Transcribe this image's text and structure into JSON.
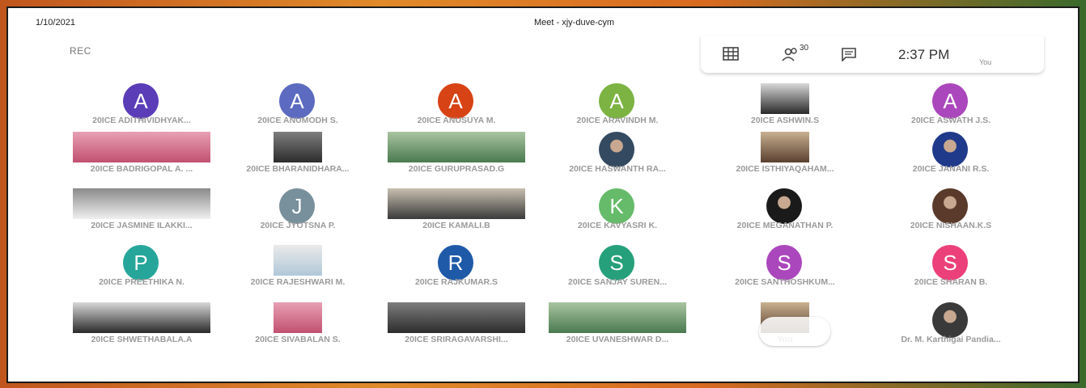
{
  "header": {
    "date": "1/10/2021",
    "meeting_title": "Meet - xjy-duve-cym",
    "rec_label": "REC"
  },
  "toolbar": {
    "grid_icon": "grid-layout-icon",
    "people_icon": "people-icon",
    "participant_count": "30",
    "chat_icon": "chat-icon",
    "time": "2:37  PM",
    "you_label": "You"
  },
  "colors": {
    "frame": "#b84a1c",
    "panel": "#ffffff",
    "name_text": "#9a9a9a"
  },
  "participants": [
    {
      "name": "20ICE ADITHIVIDHYAK...",
      "avatar": "A",
      "color": "#5b3db8",
      "kind": "avatar"
    },
    {
      "name": "20ICE ANUMODH S.",
      "avatar": "A",
      "color": "#5c6bc0",
      "kind": "avatar"
    },
    {
      "name": "20ICE ANUSUYA M.",
      "avatar": "A",
      "color": "#d84315",
      "kind": "avatar"
    },
    {
      "name": "20ICE ARAVINDH M.",
      "avatar": "A",
      "color": "#7cb342",
      "kind": "avatar"
    },
    {
      "name": "20ICE ASHWIN.S",
      "kind": "video"
    },
    {
      "name": "20ICE ASWATH J.S.",
      "avatar": "A",
      "color": "#ab47bc",
      "kind": "avatar"
    },
    {
      "name": "20ICE BADRIGOPAL A. ...",
      "kind": "video"
    },
    {
      "name": "20ICE BHARANIDHARA...",
      "kind": "video"
    },
    {
      "name": "20ICE GURUPRASAD.G",
      "kind": "video"
    },
    {
      "name": "20ICE HASWANTH RA...",
      "kind": "photo"
    },
    {
      "name": "20ICE ISTHIYAQAHAM...",
      "kind": "video"
    },
    {
      "name": "20ICE JANANI R.S.",
      "kind": "photo"
    },
    {
      "name": "20ICE JASMINE ILAKKI...",
      "kind": "video"
    },
    {
      "name": "20ICE JYOTSNA P.",
      "avatar": "J",
      "color": "#78909c",
      "kind": "avatar"
    },
    {
      "name": "20ICE KAMALI.B",
      "kind": "video"
    },
    {
      "name": "20ICE KAVYASRI K.",
      "avatar": "K",
      "color": "#66bb6a",
      "kind": "avatar"
    },
    {
      "name": "20ICE MEGANATHAN P.",
      "kind": "photo"
    },
    {
      "name": "20ICE NISHAAN.K.S",
      "kind": "photo"
    },
    {
      "name": "20ICE PREETHIKA N.",
      "avatar": "P",
      "color": "#26a69a",
      "kind": "avatar"
    },
    {
      "name": "20ICE RAJESHWARI M.",
      "kind": "video"
    },
    {
      "name": "20ICE RAJKUMAR.S",
      "avatar": "R",
      "color": "#1e5aa8",
      "kind": "avatar"
    },
    {
      "name": "20ICE SANJAY SUREN...",
      "avatar": "S",
      "color": "#26a07a",
      "kind": "avatar"
    },
    {
      "name": "20ICE SANTHOSHKUM...",
      "avatar": "S",
      "color": "#ab47bc",
      "kind": "avatar"
    },
    {
      "name": "20ICE SHARAN B.",
      "avatar": "S",
      "color": "#ec407a",
      "kind": "avatar"
    },
    {
      "name": "20ICE SHWETHABALA.A",
      "kind": "video"
    },
    {
      "name": "20ICE SIVABALAN S.",
      "kind": "video"
    },
    {
      "name": "20ICE SRIRAGAVARSHI...",
      "kind": "video"
    },
    {
      "name": "20ICE UVANESHWAR D...",
      "kind": "video"
    },
    {
      "name": "You",
      "kind": "video"
    },
    {
      "name": "Dr. M. Karthigai Pandia...",
      "kind": "photo"
    }
  ]
}
